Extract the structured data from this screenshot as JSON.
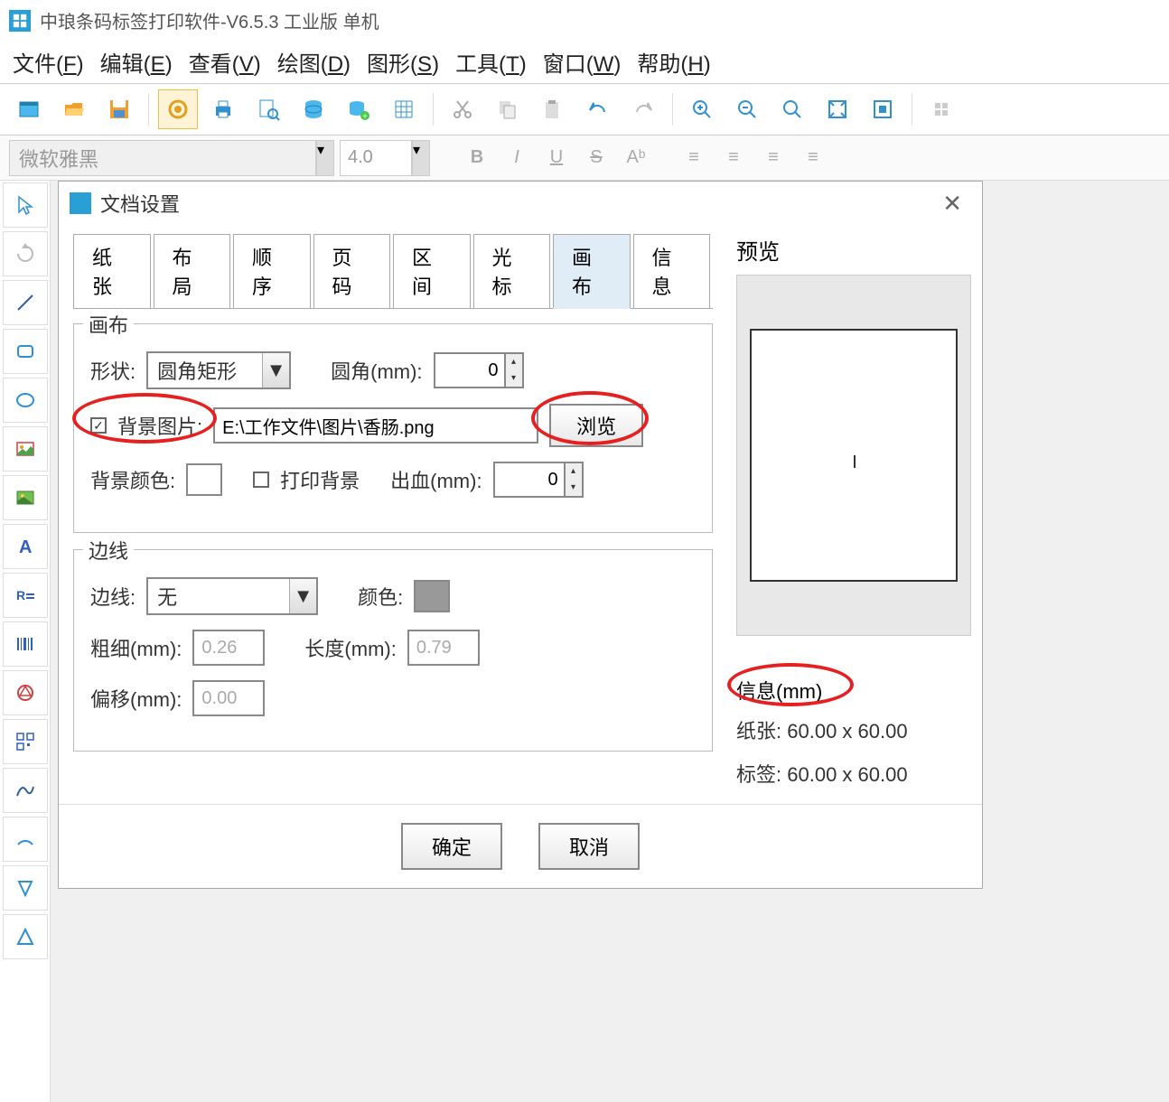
{
  "app": {
    "title": "中琅条码标签打印软件-V6.5.3 工业版 单机"
  },
  "menubar": {
    "file": "文件(F)",
    "edit": "编辑(E)",
    "view": "查看(V)",
    "draw": "绘图(D)",
    "shape": "图形(S)",
    "tool": "工具(T)",
    "window": "窗口(W)",
    "help": "帮助(H)"
  },
  "format": {
    "font": "微软雅黑",
    "size": "4.0"
  },
  "dialog": {
    "title": "文档设置",
    "tabs": {
      "paper": "纸张",
      "layout": "布局",
      "order": "顺序",
      "page": "页码",
      "range": "区间",
      "cursor": "光标",
      "canvas": "画布",
      "info": "信息"
    },
    "canvas": {
      "legend": "画布",
      "shape_label": "形状:",
      "shape_value": "圆角矩形",
      "radius_label": "圆角(mm):",
      "radius_value": "0",
      "bgimg_label": "背景图片:",
      "bgimg_path": "E:\\工作文件\\图片\\香肠.png",
      "browse": "浏览",
      "bgcolor_label": "背景颜色:",
      "printbg_label": "打印背景",
      "bleed_label": "出血(mm):",
      "bleed_value": "0"
    },
    "border": {
      "legend": "边线",
      "border_label": "边线:",
      "border_value": "无",
      "color_label": "颜色:",
      "thick_label": "粗细(mm):",
      "thick_value": "0.26",
      "length_label": "长度(mm):",
      "length_value": "0.79",
      "offset_label": "偏移(mm):",
      "offset_value": "0.00"
    },
    "preview": {
      "label": "预览"
    },
    "info_section": {
      "title": "信息(mm)",
      "paper_label": "纸张:",
      "paper_value": "60.00 x 60.00",
      "label_label": "标签:",
      "label_value": "60.00 x 60.00"
    },
    "ok": "确定",
    "cancel": "取消"
  }
}
